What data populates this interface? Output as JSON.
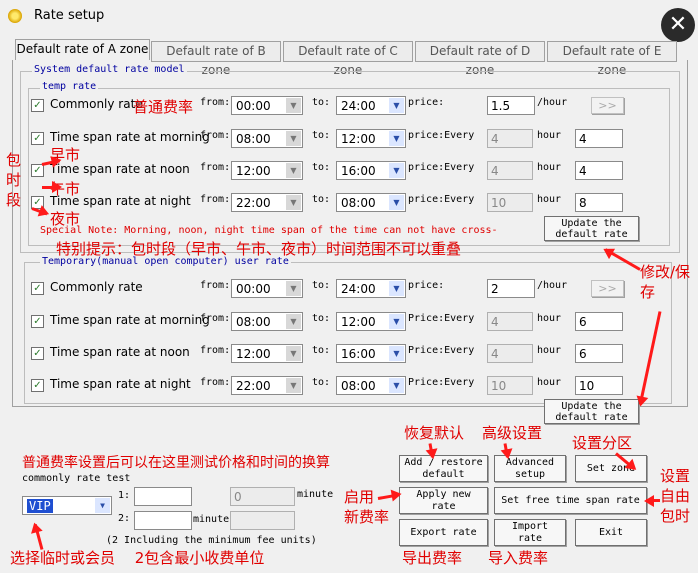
{
  "window": {
    "title": "Rate setup",
    "close": "✕"
  },
  "tabs": [
    "Default rate of A zone",
    "Default rate of B zone",
    "Default rate of C zone",
    "Default rate of D zone",
    "Default rate of E zone"
  ],
  "system": {
    "group_label": "System default rate model",
    "sub_label": "temp rate",
    "rows": [
      {
        "label": "Commonly rate",
        "from": "00:00",
        "to": "24:00",
        "price_label": "price:",
        "price": "1.5",
        "unit": "/hour",
        "extra": ">>"
      },
      {
        "label": "Time span rate at morning",
        "from": "08:00",
        "to": "12:00",
        "price_label": "price:Every",
        "hours": "4",
        "unit": "hour",
        "price": "4"
      },
      {
        "label": "Time span rate at noon",
        "from": "12:00",
        "to": "16:00",
        "price_label": "price:Every",
        "hours": "4",
        "unit": "hour",
        "price": "4"
      },
      {
        "label": "Time span rate at night",
        "from": "22:00",
        "to": "08:00",
        "price_label": "price:Every",
        "hours": "10",
        "unit": "hour",
        "price": "8"
      }
    ],
    "note": "Special Note: Morning, noon, night time span of the time can not have cross-",
    "update_btn": [
      "Update the",
      "default rate"
    ]
  },
  "temporary": {
    "group_label": "Temporary(manual open computer) user rate",
    "rows": [
      {
        "label": "Commonly rate",
        "from": "00:00",
        "to": "24:00",
        "price_label": "price:",
        "price": "2",
        "unit": "/hour",
        "extra": ">>"
      },
      {
        "label": "Time span rate at morning",
        "from": "08:00",
        "to": "12:00",
        "price_label": "Price:Every",
        "hours": "4",
        "unit": "hour",
        "price": "6"
      },
      {
        "label": "Time span rate at noon",
        "from": "12:00",
        "to": "16:00",
        "price_label": "Price:Every",
        "hours": "4",
        "unit": "hour",
        "price": "6"
      },
      {
        "label": "Time span rate at night",
        "from": "22:00",
        "to": "08:00",
        "price_label": "Price:Every",
        "hours": "10",
        "unit": "hour",
        "price": "10"
      }
    ],
    "update_btn": [
      "Update the",
      "default rate"
    ]
  },
  "labels": {
    "from": "from:",
    "to": "to:"
  },
  "test": {
    "label": "commonly rate test",
    "member_select": "VIP",
    "row1": "1:",
    "row2": "2:",
    "result1": "0",
    "minute1": "minute",
    "minute2": "minute",
    "footnote": "(2 Including the minimum fee units)"
  },
  "buttons": {
    "restore": [
      "Add / restore",
      "default"
    ],
    "advanced": [
      "Advanced",
      "setup"
    ],
    "zone": "Set zone",
    "apply": [
      "Apply new",
      "rate"
    ],
    "free_span": "Set free time span rate",
    "export": "Export rate",
    "import": [
      "Import",
      "rate"
    ],
    "exit": "Exit"
  },
  "annotations": {
    "common_rate": "普通费率",
    "baoshi": [
      "包",
      "时",
      "段"
    ],
    "morning": "早市",
    "noon": "午市",
    "night": "夜市",
    "note_cn": "特别提示：包时段（早市、午市、夜市）时间范围不可以重叠",
    "modify": [
      "修改/保",
      "存"
    ],
    "restore": "恢复默认",
    "advanced": "高级设置",
    "zone": "设置分区",
    "custom": [
      "设置",
      "自由",
      "包时"
    ],
    "test": "普通费率设置后可以在这里测试价格和时间的换算",
    "apply": [
      "启用",
      "新费率"
    ],
    "export": "导出费率",
    "import": "导入费率",
    "bottom": "选择临时或会员　 2包含最小收费单位"
  }
}
